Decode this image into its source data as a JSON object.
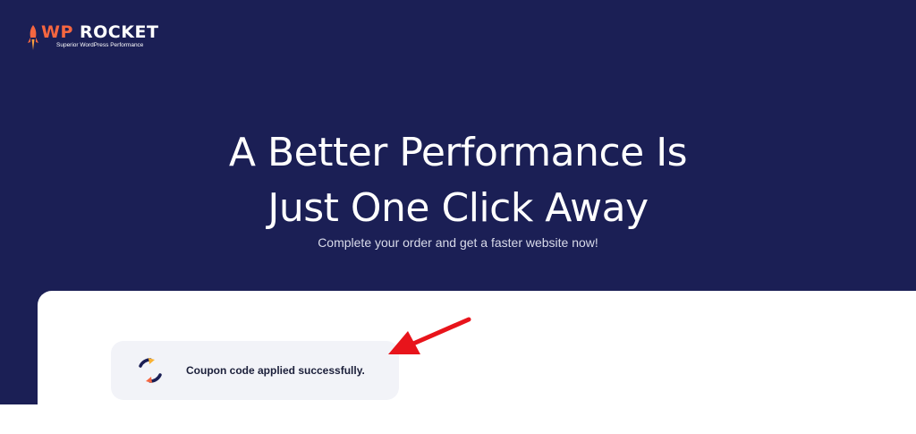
{
  "brand": {
    "prefix": "WP",
    "name": "ROCKET",
    "tagline": "Superior WordPress Performance",
    "colors": {
      "background": "#1b1f55",
      "accent": "#f56640"
    }
  },
  "hero": {
    "headline_line1": "A Better Performance Is",
    "headline_line2": "Just One Click Away",
    "subtitle": "Complete your order and get a faster website now!"
  },
  "notice": {
    "icon": "refresh-icon",
    "message": "Coupon code applied successfully."
  },
  "annotation": {
    "icon": "red-arrow-icon",
    "color": "#e8141b"
  }
}
